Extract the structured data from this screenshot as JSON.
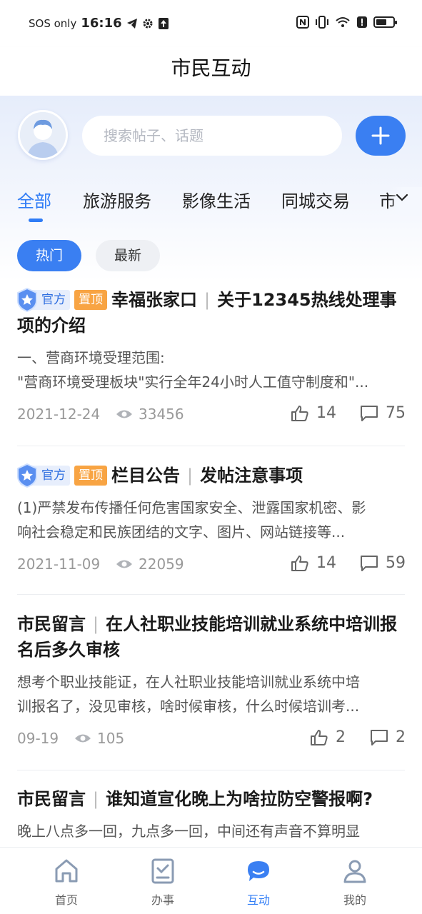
{
  "status_bar": {
    "carrier": "SOS only",
    "time": "16:16"
  },
  "header": {
    "title": "市民互动"
  },
  "search": {
    "placeholder": "搜索帖子、话题"
  },
  "tabs": [
    {
      "label": "全部",
      "active": true
    },
    {
      "label": "旅游服务",
      "active": false
    },
    {
      "label": "影像生活",
      "active": false
    },
    {
      "label": "同城交易",
      "active": false
    },
    {
      "label": "市",
      "active": false
    }
  ],
  "filters": {
    "hot": "热门",
    "new": "最新"
  },
  "posts": [
    {
      "badge_official": "官方",
      "badge_pinned": "置顶",
      "category": "幸福张家口",
      "title": "关于12345热线处理事项的介绍",
      "body_line1": "一、营商环境受理范围:",
      "body_line2": "\"营商环境受理板块\"实行全年24小时人工值守制度和\"...",
      "date": "2021-12-24",
      "views": "33456",
      "likes": "14",
      "comments": "75"
    },
    {
      "badge_official": "官方",
      "badge_pinned": "置顶",
      "category": "栏目公告",
      "title": "发帖注意事项",
      "body_line1": "(1)严禁发布传播任何危害国家安全、泄露国家机密、影",
      "body_line2": "响社会稳定和民族团结的文字、图片、网站链接等...",
      "date": "2021-11-09",
      "views": "22059",
      "likes": "14",
      "comments": "59"
    },
    {
      "category": "市民留言",
      "title": "在人社职业技能培训就业系统中培训报名后多久审核",
      "body_line1": "想考个职业技能证，在人社职业技能培训就业系统中培",
      "body_line2": "训报名了，没见审核，啥时候审核，什么时候培训考...",
      "date": "09-19",
      "views": "105",
      "likes": "2",
      "comments": "2"
    },
    {
      "category": "市民留言",
      "title": "谁知道宣化晚上为啥拉防空警报啊?",
      "body_line1": "晚上八点多一回，九点多一回，中间还有声音不算明显"
    }
  ],
  "bottom_nav": [
    {
      "label": "首页",
      "icon": "home-icon",
      "active": false
    },
    {
      "label": "办事",
      "icon": "checklist-icon",
      "active": false
    },
    {
      "label": "互动",
      "icon": "chat-icon",
      "active": true
    },
    {
      "label": "我的",
      "icon": "profile-icon",
      "active": false
    }
  ],
  "colors": {
    "accent": "#2f7cf6",
    "pinned": "#f8a443",
    "official_bg": "#e7eefc"
  }
}
